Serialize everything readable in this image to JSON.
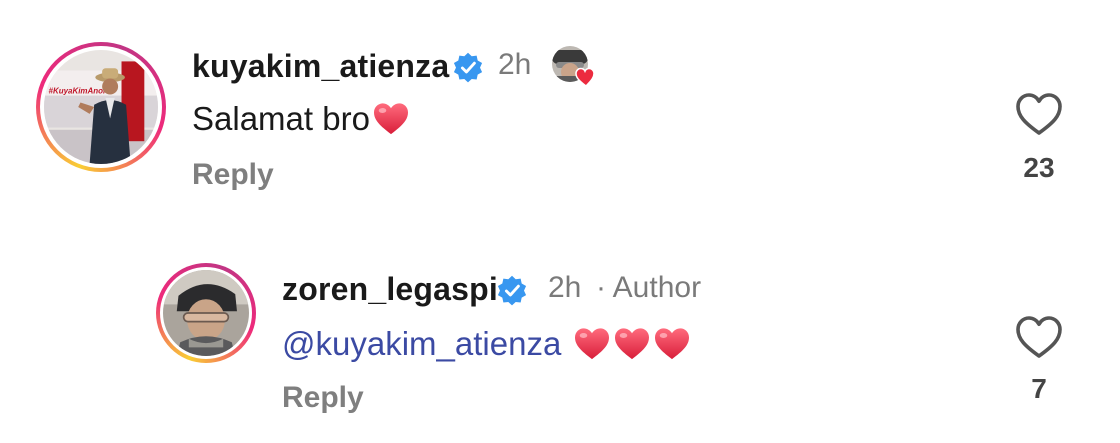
{
  "comments": [
    {
      "username": "kuyakim_atienza",
      "time": "2h",
      "author_tag": "",
      "text": "Salamat bro",
      "mention": "",
      "reply_label": "Reply",
      "likes": "23",
      "avatar_banner_text": "#KuyaKimAnoNa"
    },
    {
      "username": "zoren_legaspi",
      "time": "2h",
      "author_tag": "· Author",
      "text": "",
      "mention": "@kuyakim_atienza",
      "reply_label": "Reply",
      "likes": "7"
    }
  ],
  "colors": {
    "verified_blue": "#3897f0",
    "mention_blue": "#3b4aa3",
    "heart_red": "#e8304a",
    "ring_gradient": [
      "#f9ce34",
      "#ee2a7b",
      "#c13584"
    ]
  },
  "icons": {
    "verified": "verified-badge-icon",
    "like": "heart-outline-icon",
    "emoji": "red-heart-emoji"
  }
}
